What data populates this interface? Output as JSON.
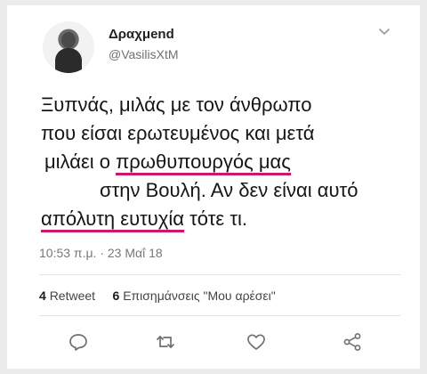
{
  "user": {
    "display_name": "Δραχμend",
    "handle": "@VasilisXtM"
  },
  "tweet": {
    "line1": "Ξυπνάς, μιλάς με τον άνθρωπο",
    "line2": "που είσαι ερωτευμένος και μετά",
    "line3_pre": "μιλάει ο ",
    "line3_hl": "πρωθυπουργός μας",
    "line4": "στην Βουλή. Αν δεν είναι αυτό",
    "line5_hl": "απόλυτη ευτυχία",
    "line5_post": " τότε τι.",
    "highlight_color": "#d0156e"
  },
  "meta": {
    "timestamp": "10:53 π.μ. · 23 Μαΐ 18"
  },
  "stats": {
    "retweet_count": "4",
    "retweet_label": "Retweet",
    "likes_count": "6",
    "likes_label": "Επισημάνσεις \"Μου αρέσει\""
  },
  "icons": {
    "reply": "reply-icon",
    "retweet": "retweet-icon",
    "like": "heart-icon",
    "share": "share-icon",
    "menu": "chevron-down-icon"
  }
}
